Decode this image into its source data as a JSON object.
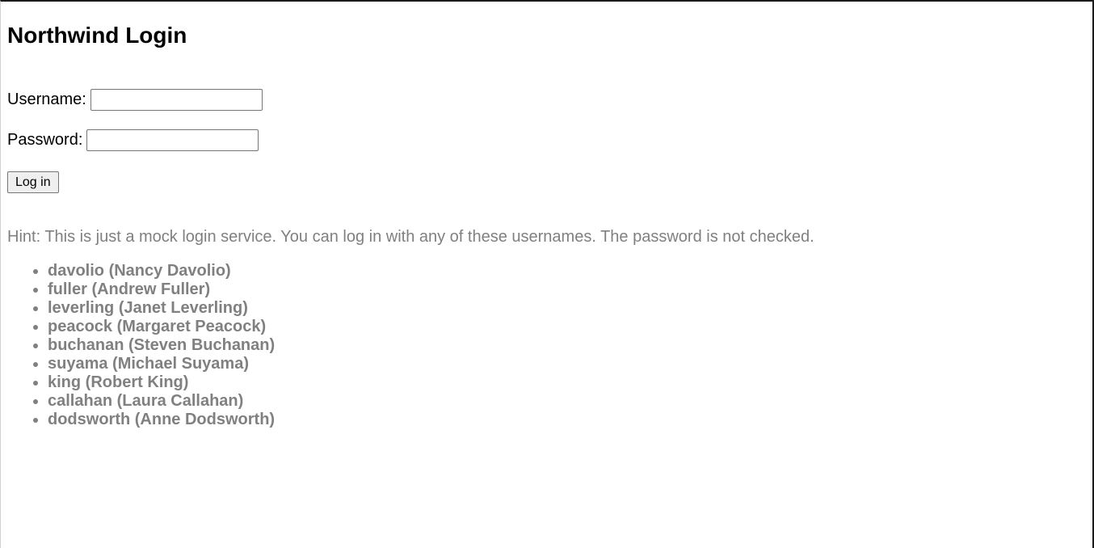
{
  "page": {
    "title": "Northwind Login"
  },
  "form": {
    "username_label": "Username:",
    "username_value": "",
    "password_label": "Password:",
    "password_value": "",
    "submit_label": "Log in"
  },
  "hint": {
    "text": "Hint: This is just a mock login service. You can log in with any of these usernames. The password is not checked."
  },
  "users": [
    {
      "label": "davolio (Nancy Davolio)"
    },
    {
      "label": "fuller (Andrew Fuller)"
    },
    {
      "label": "leverling (Janet Leverling)"
    },
    {
      "label": "peacock (Margaret Peacock)"
    },
    {
      "label": "buchanan (Steven Buchanan)"
    },
    {
      "label": "suyama (Michael Suyama)"
    },
    {
      "label": "king (Robert King)"
    },
    {
      "label": "callahan (Laura Callahan)"
    },
    {
      "label": "dodsworth (Anne Dodsworth)"
    }
  ],
  "colors": {
    "hint_text": "#808080",
    "heading_text": "#000000",
    "button_background": "#efefef"
  }
}
